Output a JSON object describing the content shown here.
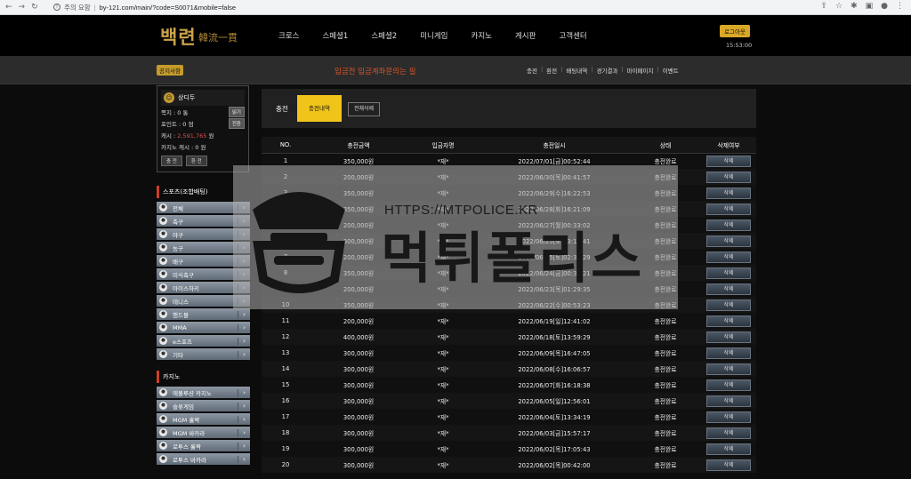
{
  "browser": {
    "security_label": "주의 요함",
    "url": "by-121.com/main/?code=S0071&mobile=false"
  },
  "header": {
    "logo_text": "백련",
    "logo_sub": "韓流一貫",
    "nav": [
      "크로스",
      "스페셜1",
      "스페셜2",
      "미니게임",
      "카지노",
      "게시판",
      "고객센터"
    ],
    "logout": "로그아웃",
    "clock": "15:53:00"
  },
  "subbar": {
    "notice_badge": "공지사항",
    "marquee": "입금전 입금계좌문의는 필",
    "links": [
      "충전",
      "환전",
      "배팅내역",
      "경기결과",
      "마이페이지",
      "이벤트"
    ]
  },
  "user": {
    "name": "상디두",
    "rows": [
      {
        "label": "쪽지 : 0 통",
        "button": "읽기"
      },
      {
        "label": "포인트 : 0 점",
        "button": "전환"
      },
      {
        "label_prefix": "캐시 : ",
        "label_value": "2,591,765",
        "label_suffix": " 원",
        "button": ""
      },
      {
        "label": "카지노 캐시 : 0 원",
        "button": ""
      }
    ],
    "buttons": [
      "충 전",
      "환 전"
    ]
  },
  "sports": {
    "title": "스포츠(조합배팅)",
    "items": [
      {
        "label": "전체",
        "icon": "all-icon"
      },
      {
        "label": "축구",
        "icon": "soccer-icon"
      },
      {
        "label": "야구",
        "icon": "baseball-icon"
      },
      {
        "label": "농구",
        "icon": "basketball-icon"
      },
      {
        "label": "배구",
        "icon": "volleyball-icon"
      },
      {
        "label": "미식축구",
        "icon": "football-icon"
      },
      {
        "label": "아이스하키",
        "icon": "hockey-icon"
      },
      {
        "label": "테니스",
        "icon": "tennis-icon"
      },
      {
        "label": "핸드볼",
        "icon": "handball-icon"
      },
      {
        "label": "MMA",
        "icon": "mma-icon"
      },
      {
        "label": "e스포츠",
        "icon": "gamepad-icon"
      },
      {
        "label": "기타",
        "icon": "etc-icon"
      }
    ]
  },
  "casino": {
    "title": "카지노",
    "items": [
      {
        "label": "에볼루션 카지노",
        "icon": "casino-icon"
      },
      {
        "label": "슬롯게임",
        "icon": "slot-icon"
      },
      {
        "label": "MGM 홀짝",
        "icon": "mgm-icon"
      },
      {
        "label": "MGM 바카라",
        "icon": "mgm-icon"
      },
      {
        "label": "로투스 홀짝",
        "icon": "lotus-icon"
      },
      {
        "label": "로투스 바카라",
        "icon": "lotus-icon"
      }
    ]
  },
  "content": {
    "section_label": "충전",
    "tab_active": "충전내역",
    "delete_all": "전체삭제",
    "columns": [
      "NO.",
      "충전금액",
      "입금자명",
      "충전일시",
      "상태",
      "삭제여부"
    ],
    "delete_label": "삭제",
    "rows": [
      {
        "no": "1",
        "amount": "350,000원",
        "name": "*재*",
        "date": "2022/07/01[금]00:52:44",
        "status": "충전완료"
      },
      {
        "no": "2",
        "amount": "200,000원",
        "name": "*재*",
        "date": "2022/06/30[목]00:41:57",
        "status": "충전완료"
      },
      {
        "no": "3",
        "amount": "350,000원",
        "name": "*재*",
        "date": "2022/06/29[수]16:22:53",
        "status": "충전완료"
      },
      {
        "no": "4",
        "amount": "350,000원",
        "name": "*재*",
        "date": "2022/06/28[화]16:21:09",
        "status": "충전완료"
      },
      {
        "no": "5",
        "amount": "200,000원",
        "name": "*재*",
        "date": "2022/06/27[월]00:33:02",
        "status": "충전완료"
      },
      {
        "no": "6",
        "amount": "300,000원",
        "name": "*재*",
        "date": "2022/06/25[토]13:11:41",
        "status": "충전완료"
      },
      {
        "no": "7",
        "amount": "200,000원",
        "name": "*재*",
        "date": "2022/06/25[토]02:39:29",
        "status": "충전완료"
      },
      {
        "no": "8",
        "amount": "350,000원",
        "name": "*재*",
        "date": "2022/06/24[금]00:38:21",
        "status": "충전완료"
      },
      {
        "no": "9",
        "amount": "200,000원",
        "name": "*재*",
        "date": "2022/06/23[목]01:29:35",
        "status": "충전완료"
      },
      {
        "no": "10",
        "amount": "350,000원",
        "name": "*재*",
        "date": "2022/06/22[수]00:53:23",
        "status": "충전완료"
      },
      {
        "no": "11",
        "amount": "200,000원",
        "name": "*재*",
        "date": "2022/06/19[일]12:41:02",
        "status": "충전완료"
      },
      {
        "no": "12",
        "amount": "400,000원",
        "name": "*재*",
        "date": "2022/06/18[토]13:59:29",
        "status": "충전완료"
      },
      {
        "no": "13",
        "amount": "300,000원",
        "name": "*재*",
        "date": "2022/06/09[목]16:47:05",
        "status": "충전완료"
      },
      {
        "no": "14",
        "amount": "300,000원",
        "name": "*재*",
        "date": "2022/06/08[수]16:06:57",
        "status": "충전완료"
      },
      {
        "no": "15",
        "amount": "300,000원",
        "name": "*재*",
        "date": "2022/06/07[화]16:18:38",
        "status": "충전완료"
      },
      {
        "no": "16",
        "amount": "300,000원",
        "name": "*재*",
        "date": "2022/06/05[일]12:56:01",
        "status": "충전완료"
      },
      {
        "no": "17",
        "amount": "300,000원",
        "name": "*재*",
        "date": "2022/06/04[토]13:34:19",
        "status": "충전완료"
      },
      {
        "no": "18",
        "amount": "300,000원",
        "name": "*재*",
        "date": "2022/06/03[금]15:57:17",
        "status": "충전완료"
      },
      {
        "no": "19",
        "amount": "300,000원",
        "name": "*재*",
        "date": "2022/06/02[목]17:05:43",
        "status": "충전완료"
      },
      {
        "no": "20",
        "amount": "300,000원",
        "name": "*재*",
        "date": "2022/06/02[목]00:42:00",
        "status": "충전완료"
      }
    ]
  },
  "watermark": {
    "url": "HTTPS://MTPOLICE.KR",
    "text": "먹튀폴리스"
  },
  "colors": {
    "accent": "#f0c419",
    "marquee": "#d4542b",
    "cash": "#e05050",
    "section_marker": "#c9402a"
  }
}
